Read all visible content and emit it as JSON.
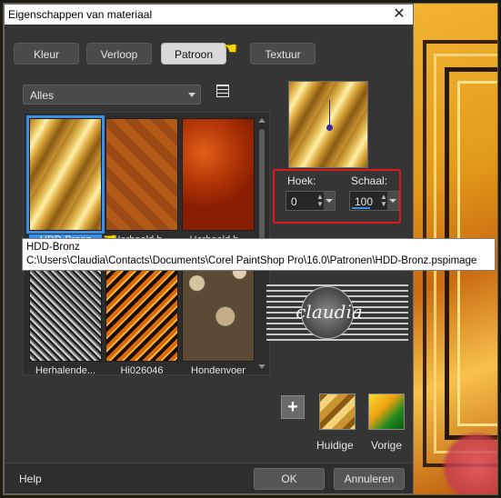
{
  "window": {
    "title": "Eigenschappen van materiaal"
  },
  "tabs": [
    {
      "label": "Kleur"
    },
    {
      "label": "Verloop"
    },
    {
      "label": "Patroon",
      "active": true
    },
    {
      "label": "Textuur"
    }
  ],
  "filter": {
    "selected": "Alles"
  },
  "gallery": {
    "items": [
      {
        "label": "HDD-Bronz",
        "style": "bronze",
        "selected": true
      },
      {
        "label": "Herhaald h...",
        "style": "herhaald1"
      },
      {
        "label": "Herhaald h...",
        "style": "herhaald2"
      },
      {
        "label": "Herhalende...",
        "style": "herhalende"
      },
      {
        "label": "Hi026046",
        "style": "hi026046"
      },
      {
        "label": "Hondenvoer",
        "style": "hondenvoer"
      }
    ]
  },
  "tooltip": {
    "name": "HDD-Bronz",
    "path": "C:\\Users\\Claudia\\Contacts\\Documents\\Corel PaintShop Pro\\16.0\\Patronen\\HDD-Bronz.pspimage"
  },
  "angle": {
    "label": "Hoek:",
    "value": "0"
  },
  "scale": {
    "label": "Schaal:",
    "value": "100"
  },
  "watermark_text": "claudia",
  "swatches": {
    "current_label": "Huidige",
    "previous_label": "Vorige"
  },
  "buttons": {
    "help": "Help",
    "ok": "OK",
    "cancel": "Annuleren"
  },
  "colors": {
    "selection": "#3a8fe8",
    "highlight_box": "#e01818",
    "pointer": "#f5d400"
  },
  "icons": {
    "close": "close-icon",
    "pointer": "hand-pointer-icon",
    "options": "options-list-icon",
    "add": "plus-icon"
  }
}
